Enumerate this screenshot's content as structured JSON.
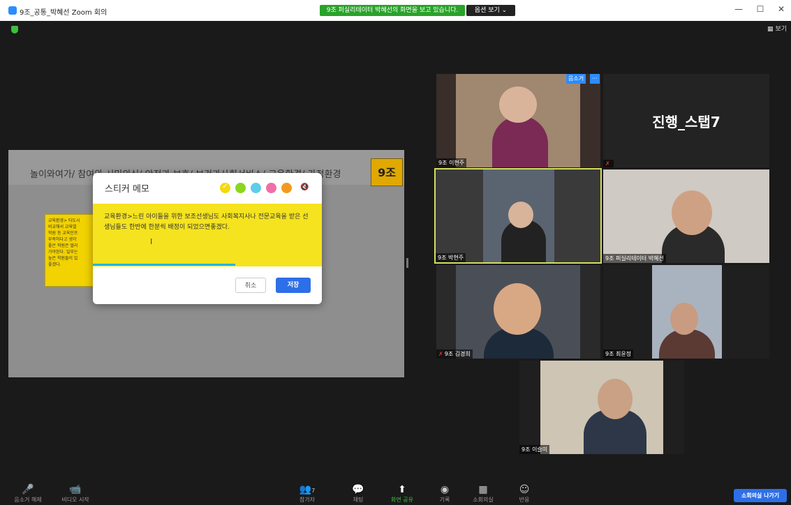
{
  "window": {
    "title": "9조_공통_박혜선   Zoom 회의",
    "minimize": "—",
    "maximize": "☐",
    "close": "✕"
  },
  "banner": {
    "sharing_text": "9조 퍼실리테이터 박혜선의 화면을 보고 있습니다.",
    "view_options": "옵션 보기 ⌄"
  },
  "top_right": {
    "view_label": "보기"
  },
  "shared_screen": {
    "headline": "놀이와여가/ 참여와 시민의식/ 안전과 보호/ 보건과사회서비스/ 교육환경/ 가정환경",
    "group_tag": "9조",
    "sticky_lines": [
      "교육환경> 타도시",
      "비교해서 교육열",
      "학원 등 교육인프",
      "부족하다고 생각",
      "좋은 학원은 멀리",
      "가야된다. 일부는",
      "높은 학원들이 있",
      "좋겠다."
    ]
  },
  "dialog": {
    "title": "스티커 메모",
    "colors": [
      "#f5d90a",
      "#8cd61e",
      "#5fcde8",
      "#f06fa8",
      "#f39a1e"
    ],
    "mute_icon": "🔇",
    "text": "교육환경>느린 아이들을 위한 보조선생님도 사회복지사나 전문교육을 받은 선생님들도 한반에 한분씩 배정이 되었으면좋겠다.",
    "cursor": "I",
    "cancel_label": "취소",
    "save_label": "저장"
  },
  "participants": [
    {
      "name": "9조 이현주",
      "muted": false
    },
    {
      "name": "",
      "muted": true,
      "big_text": "진행_스탭7"
    },
    {
      "name": "9조 박현주",
      "muted": false
    },
    {
      "name": "9조 퍼실리테이터 박혜선",
      "muted": false
    },
    {
      "name": "9조 김경희",
      "muted": true
    },
    {
      "name": "9조 최윤정",
      "muted": false
    },
    {
      "name": "9조 이슬미",
      "muted": false
    }
  ],
  "tile_controls": {
    "unmute": "음소거",
    "more": "···"
  },
  "toolbar": {
    "unmute": "음소거 해제",
    "video": "비디오 시작",
    "participants": "참가자",
    "participants_count": "7",
    "chat": "채팅",
    "share": "화면 공유",
    "record": "기록",
    "breakout": "소회의실",
    "reactions": "반응",
    "leave": "소회의실 나가기"
  }
}
